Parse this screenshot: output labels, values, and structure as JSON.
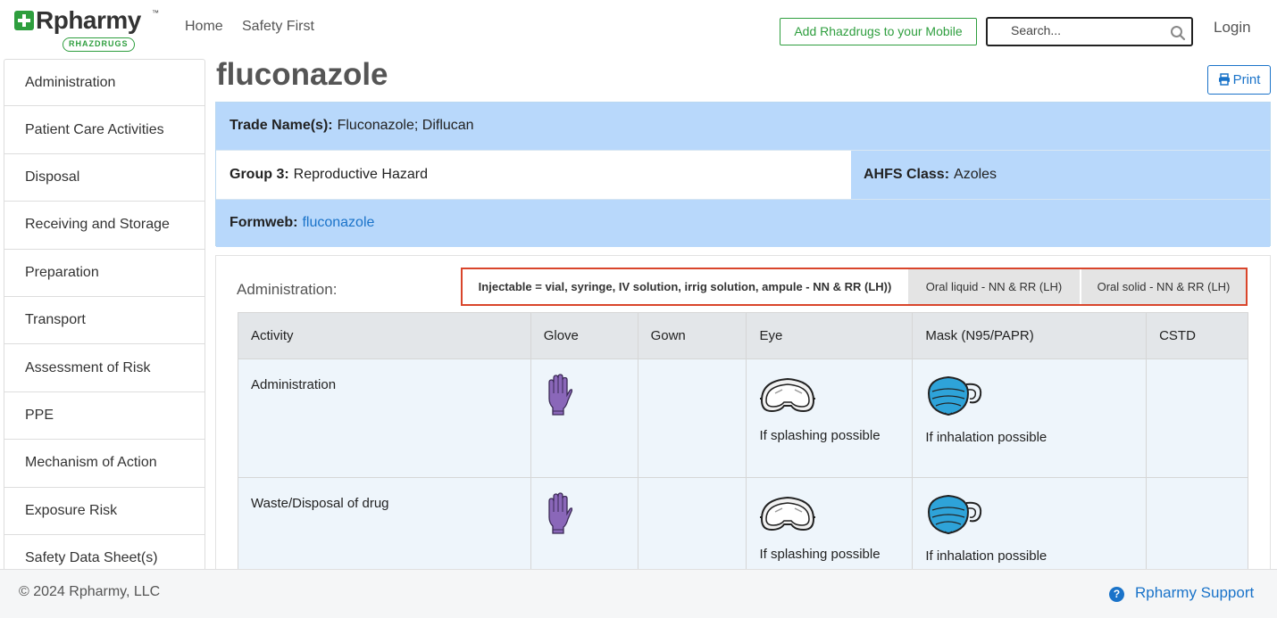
{
  "brand": {
    "name": "Rpharmy",
    "tm": "™",
    "badge": "RHAZDRUGS"
  },
  "nav": {
    "home": "Home",
    "safety": "Safety First"
  },
  "header": {
    "add_mobile": "Add Rhazdrugs to your Mobile",
    "search_placeholder": "Search...",
    "login": "Login"
  },
  "sidebar": {
    "items": [
      "Administration",
      "Patient Care Activities",
      "Disposal",
      "Receiving and Storage",
      "Preparation",
      "Transport",
      "Assessment of Risk",
      "PPE",
      "Mechanism of Action",
      "Exposure Risk",
      "Safety Data Sheet(s)"
    ]
  },
  "drug": {
    "title": "fluconazole",
    "print": "Print",
    "trade_label": "Trade Name(s):",
    "trade_value": "Fluconazole; Diflucan",
    "group_label": "Group 3:",
    "group_value": "Reproductive Hazard",
    "ahfs_label": "AHFS Class:",
    "ahfs_value": "Azoles",
    "formweb_label": "Formweb:",
    "formweb_value": "fluconazole"
  },
  "admin": {
    "label": "Administration:",
    "tabs": [
      "Injectable = vial, syringe, IV solution, irrig solution, ampule - NN & RR (LH))",
      "Oral liquid - NN & RR (LH)",
      "Oral solid - NN & RR (LH)"
    ],
    "columns": [
      "Activity",
      "Glove",
      "Gown",
      "Eye",
      "Mask (N95/PAPR)",
      "CSTD"
    ],
    "rows": [
      {
        "activity": "Administration",
        "glove_icon": "glove-icon",
        "eye_icon": "goggles-icon",
        "eye_text": "If splashing possible",
        "mask_icon": "n95-mask-icon",
        "mask_text": "If inhalation possible"
      },
      {
        "activity": "Waste/Disposal of drug",
        "glove_icon": "glove-icon",
        "eye_icon": "goggles-icon",
        "eye_text": "If splashing possible",
        "mask_icon": "n95-mask-icon",
        "mask_text": "If inhalation possible"
      }
    ]
  },
  "footer": {
    "copyright": "© 2024 Rpharmy, LLC",
    "support": "Rpharmy Support"
  },
  "colors": {
    "brand_green": "#2e9e3e",
    "link_blue": "#1a73c9",
    "info_blue": "#b8d8fb",
    "tab_border": "#d9452b",
    "glove_purple": "#8a67b9",
    "mask_blue": "#2ea3d9"
  }
}
